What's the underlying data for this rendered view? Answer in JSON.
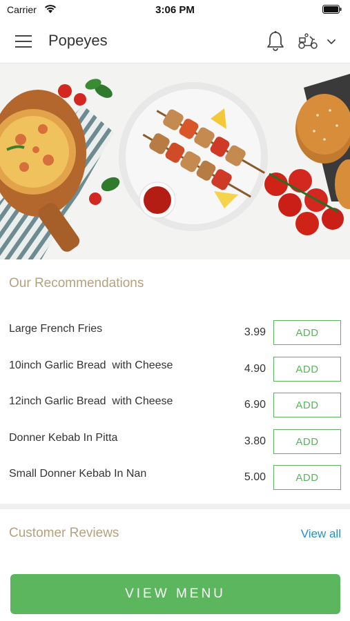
{
  "status_bar": {
    "carrier": "Carrier",
    "time": "3:06 PM"
  },
  "header": {
    "title": "Popeyes",
    "icons": [
      "menu-icon",
      "bell-icon",
      "scooter-icon",
      "chevron-down-icon"
    ]
  },
  "recommendations": {
    "title": "Our Recommendations",
    "add_label": "ADD",
    "items": [
      {
        "name": "Large French Fries",
        "price": "3.99"
      },
      {
        "name": "10inch Garlic Bread  with Cheese",
        "price": "4.90"
      },
      {
        "name": "12inch Garlic Bread  with Cheese",
        "price": "6.90"
      },
      {
        "name": "Donner Kebab In Pitta",
        "price": "3.80"
      },
      {
        "name": "Small Donner Kebab In Nan",
        "price": "5.00"
      }
    ]
  },
  "reviews": {
    "title": "Customer Reviews",
    "view_all_label": "View all"
  },
  "footer": {
    "view_menu_label": "VIEW MENU"
  },
  "colors": {
    "accent_green": "#5cb65e",
    "section_title": "#b4a27f",
    "link_blue": "#2a8fc6"
  }
}
